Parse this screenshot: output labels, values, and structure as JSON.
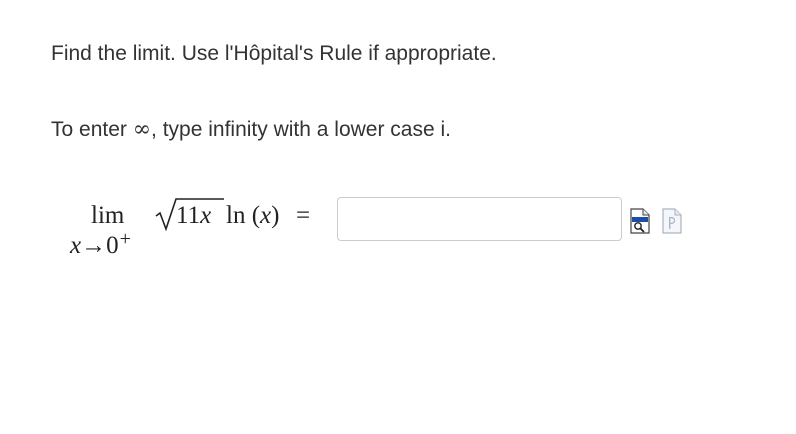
{
  "question": {
    "instruction": "Find the limit. Use l'Hôpital's Rule if appropriate.",
    "entry_hint_prefix": "To enter ",
    "infinity_symbol": "∞",
    "entry_hint_suffix": ", type infinity with a lower case i."
  },
  "expression": {
    "lim": "lim",
    "approach_var": "x",
    "arrow": "→",
    "approach_value": "0",
    "approach_side": "+",
    "radicand_coef": "11",
    "radicand_var": "x",
    "ln": "ln",
    "open_paren": "(",
    "arg_var": "x",
    "close_paren": ")",
    "equals": "="
  },
  "answer": {
    "value": "",
    "placeholder": ""
  },
  "icons": {
    "preview": "preview-icon",
    "help": "help-icon"
  }
}
